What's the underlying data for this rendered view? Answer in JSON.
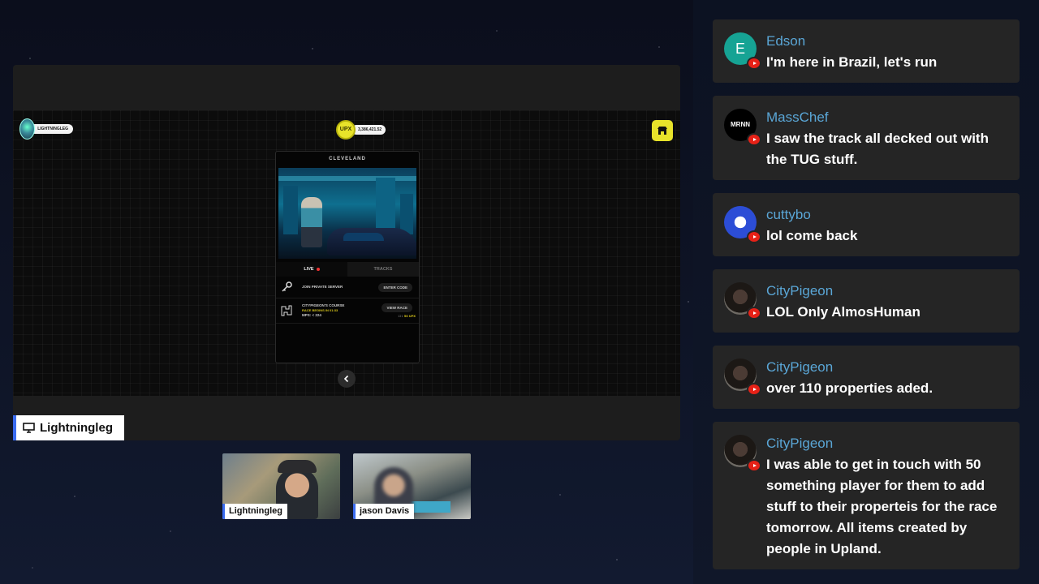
{
  "stream": {
    "player_name": "LIGHTNINGLEG",
    "upx_label": "UPX",
    "upx_amount": "3,386,421.52",
    "city": "CLEVELAND",
    "tabs": [
      "LIVE",
      "TRACKS"
    ],
    "rows": [
      {
        "label": "JOIN PRIVATE SERVER",
        "sub": "",
        "button": "ENTER CODE",
        "meta": ""
      },
      {
        "label": "CITYPIGEON'S COURSE",
        "sub": "RACE BEGINS IN 01:33",
        "sub2": "MPS: < 224",
        "button": "VIEW RACE",
        "meta": "121",
        "meta_upx": "50 UPX"
      }
    ],
    "streamer_tag": "Lightningleg",
    "participants": [
      "Lightningleg",
      "jason Davis"
    ]
  },
  "chat": [
    {
      "user": "Edson",
      "initial": "E",
      "text": "I'm here in Brazil, let's run"
    },
    {
      "user": "MassChef",
      "initial": "MRNN",
      "text": "I saw the track all decked out with the TUG stuff."
    },
    {
      "user": "cuttybo",
      "initial": "",
      "text": "lol come back"
    },
    {
      "user": "CityPigeon",
      "initial": "",
      "text": "LOL Only AlmosHuman"
    },
    {
      "user": "CityPigeon",
      "initial": "",
      "text": "over 110 properties aded."
    },
    {
      "user": "CityPigeon",
      "initial": "",
      "text": "I was able to get in touch with 50 something player for them to add stuff to their properteis for the race tomorrow. All items created by people in Upland."
    }
  ],
  "colors": {
    "accent_blue": "#3b6cf0",
    "upx_yellow": "#e8e32a",
    "username_blue": "#5aa6d6",
    "youtube_red": "#e62117"
  },
  "icons": [
    "monitor-icon",
    "store-icon",
    "key-icon",
    "track-map-icon",
    "chevron-left-icon",
    "youtube-icon"
  ]
}
